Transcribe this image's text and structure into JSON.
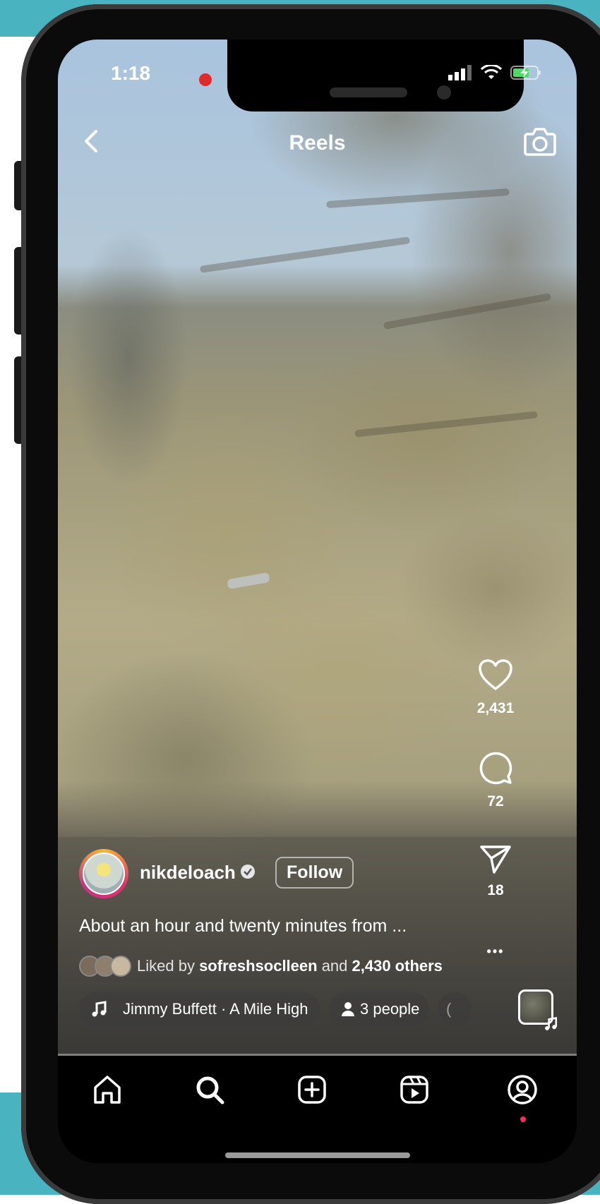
{
  "status_bar": {
    "time": "1:18"
  },
  "header": {
    "title": "Reels"
  },
  "actions": {
    "likes": "2,431",
    "comments": "72",
    "shares": "18",
    "more": "•••"
  },
  "post": {
    "username": "nikdeloach",
    "follow_label": "Follow",
    "caption": "About an hour and twenty minutes from ...",
    "liked_prefix": "Liked by ",
    "liked_user": "sofreshsoclleen",
    "liked_middle": " and ",
    "liked_others": "2,430 others"
  },
  "chips": {
    "music": "Jimmy Buffett · A Mile High",
    "people": "3 people"
  },
  "nav": {
    "items": [
      "home-icon",
      "search-icon",
      "create-icon",
      "reels-icon",
      "profile-icon"
    ]
  },
  "colors": {
    "backdrop": "#49b3c0",
    "story_ring": "#e1306c",
    "notification_dot": "#ff2d55"
  }
}
